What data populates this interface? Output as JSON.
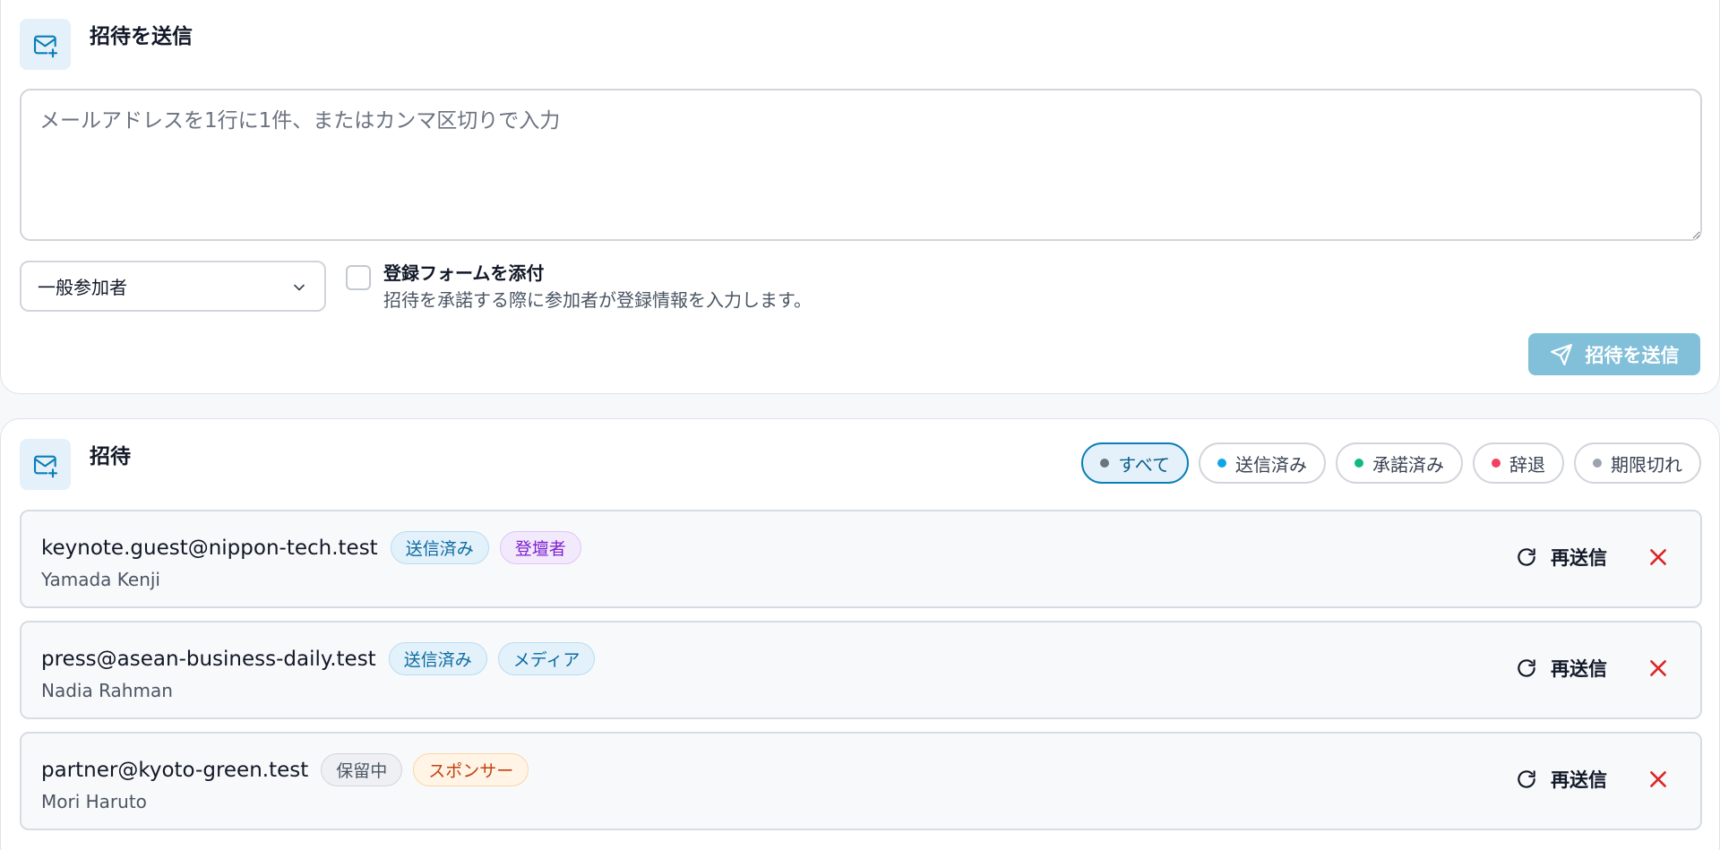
{
  "send_card": {
    "title": "招待を送信",
    "textarea_placeholder": "メールアドレスを1行に1件、またはカンマ区切りで入力",
    "textarea_value": "",
    "role_select_value": "一般参加者",
    "attach_form_label": "登録フォームを添付",
    "attach_form_help": "招待を承諾する際に参加者が登録情報を入力します。",
    "attach_form_checked": false,
    "send_button_label": "招待を送信"
  },
  "list_card": {
    "title": "招待",
    "filters": [
      {
        "label": "すべて",
        "dot_color": "#6b7280",
        "active": true
      },
      {
        "label": "送信済み",
        "dot_color": "#0ea5e9",
        "active": false
      },
      {
        "label": "承諾済み",
        "dot_color": "#10b981",
        "active": false
      },
      {
        "label": "辞退",
        "dot_color": "#f43f5e",
        "active": false
      },
      {
        "label": "期限切れ",
        "dot_color": "#9ca3af",
        "active": false
      }
    ],
    "invites": [
      {
        "email": "keynote.guest@nippon-tech.test",
        "name": "Yamada Kenji",
        "status": "送信済み",
        "role": "登壇者",
        "resend_label": "再送信"
      },
      {
        "email": "press@asean-business-daily.test",
        "name": "Nadia Rahman",
        "status": "送信済み",
        "role": "メディア",
        "resend_label": "再送信"
      },
      {
        "email": "partner@kyoto-green.test",
        "name": "Mori Haruto",
        "status": "保留中",
        "role": "スポンサー",
        "resend_label": "再送信"
      }
    ]
  },
  "colors": {
    "accent": "#0b7db8",
    "send_button_bg": "#82bfd9",
    "delete_red": "#dc2626"
  }
}
